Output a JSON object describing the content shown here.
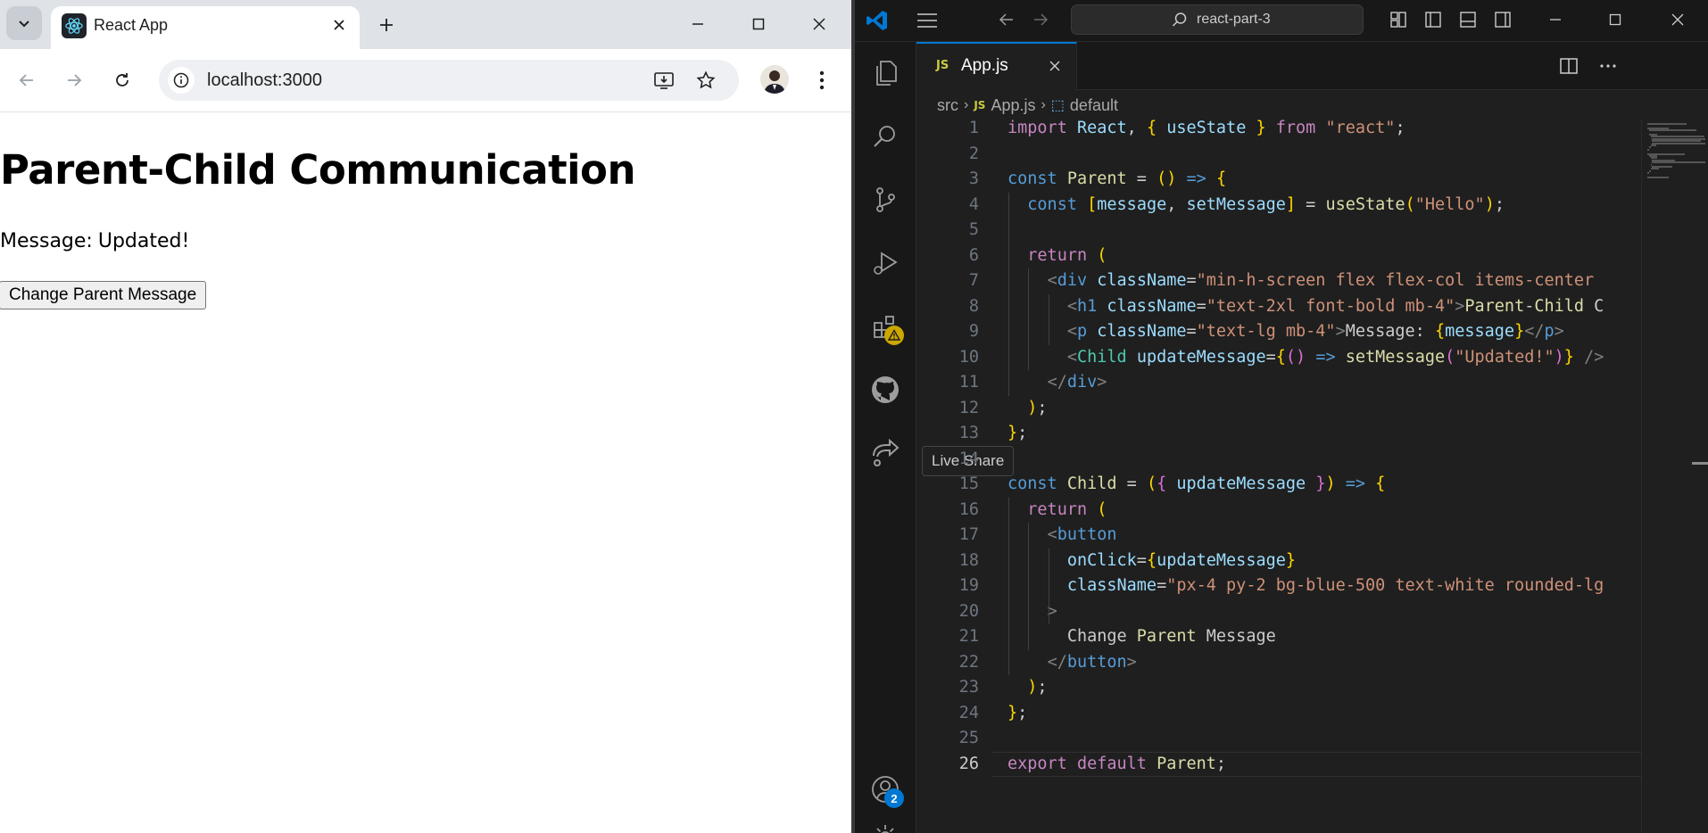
{
  "browser": {
    "tab_title": "React App",
    "url": "localhost:3000",
    "page": {
      "heading": "Parent-Child Communication",
      "message_label": "Message:",
      "message_value": "Updated!",
      "button_label": "Change Parent Message"
    }
  },
  "vscode": {
    "search": "react-part-3",
    "tab_label": "App.js",
    "tab_badge": "JS",
    "breadcrumb": [
      "src",
      "App.js",
      "default"
    ],
    "tooltip": "Live Share",
    "accounts_badge": "2",
    "current_line": "26",
    "code": [
      {
        "n": "1",
        "t": "import React, { useState } from \"react\";"
      },
      {
        "n": "2",
        "t": ""
      },
      {
        "n": "3",
        "t": "const Parent = () => {"
      },
      {
        "n": "4",
        "t": "  const [message, setMessage] = useState(\"Hello\");"
      },
      {
        "n": "5",
        "t": ""
      },
      {
        "n": "6",
        "t": "  return ("
      },
      {
        "n": "7",
        "t": "    <div className=\"min-h-screen flex flex-col items-center"
      },
      {
        "n": "8",
        "t": "      <h1 className=\"text-2xl font-bold mb-4\">Parent-Child C"
      },
      {
        "n": "9",
        "t": "      <p className=\"text-lg mb-4\">Message: {message}</p>"
      },
      {
        "n": "10",
        "t": "      <Child updateMessage={() => setMessage(\"Updated!\")} />"
      },
      {
        "n": "11",
        "t": "    </div>"
      },
      {
        "n": "12",
        "t": "  );"
      },
      {
        "n": "13",
        "t": "};"
      },
      {
        "n": "14",
        "t": ""
      },
      {
        "n": "15",
        "t": "const Child = ({ updateMessage }) => {"
      },
      {
        "n": "16",
        "t": "  return ("
      },
      {
        "n": "17",
        "t": "    <button"
      },
      {
        "n": "18",
        "t": "      onClick={updateMessage}"
      },
      {
        "n": "19",
        "t": "      className=\"px-4 py-2 bg-blue-500 text-white rounded-lg"
      },
      {
        "n": "20",
        "t": "    >"
      },
      {
        "n": "21",
        "t": "      Change Parent Message"
      },
      {
        "n": "22",
        "t": "    </button>"
      },
      {
        "n": "23",
        "t": "  );"
      },
      {
        "n": "24",
        "t": "};"
      },
      {
        "n": "25",
        "t": ""
      },
      {
        "n": "26",
        "t": "export default Parent;"
      }
    ]
  }
}
